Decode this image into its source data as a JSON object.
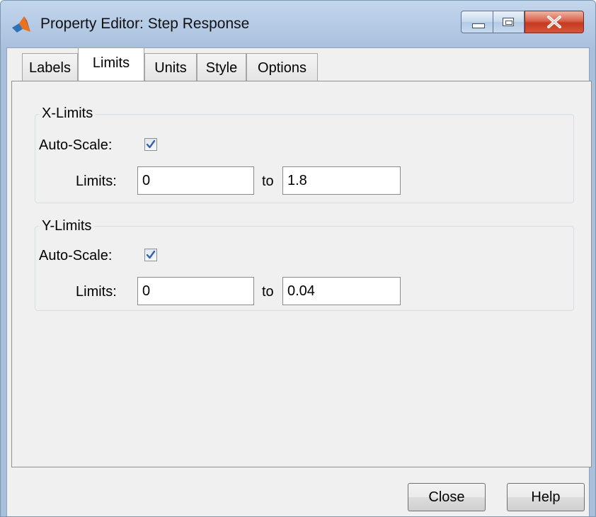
{
  "window": {
    "title": "Property Editor: Step Response",
    "app_icon": "matlab-icon",
    "controls": [
      "minimize-icon",
      "maximize-icon",
      "close-icon"
    ],
    "accent_color": "#b9cee8",
    "close_color": "#c63a21"
  },
  "tabs": [
    {
      "label": "Labels",
      "active": false
    },
    {
      "label": "Limits",
      "active": true
    },
    {
      "label": "Units",
      "active": false
    },
    {
      "label": "Style",
      "active": false
    },
    {
      "label": "Options",
      "active": false
    }
  ],
  "x_limits": {
    "group_label": "X-Limits",
    "autoscale_label": "Auto-Scale:",
    "autoscale_checked": true,
    "limits_label": "Limits:",
    "min": "0",
    "to_label": "to",
    "max": "1.8"
  },
  "y_limits": {
    "group_label": "Y-Limits",
    "autoscale_label": "Auto-Scale:",
    "autoscale_checked": true,
    "limits_label": "Limits:",
    "min": "0",
    "to_label": "to",
    "max": "0.04"
  },
  "buttons": {
    "close_label": "Close",
    "help_label": "Help"
  }
}
